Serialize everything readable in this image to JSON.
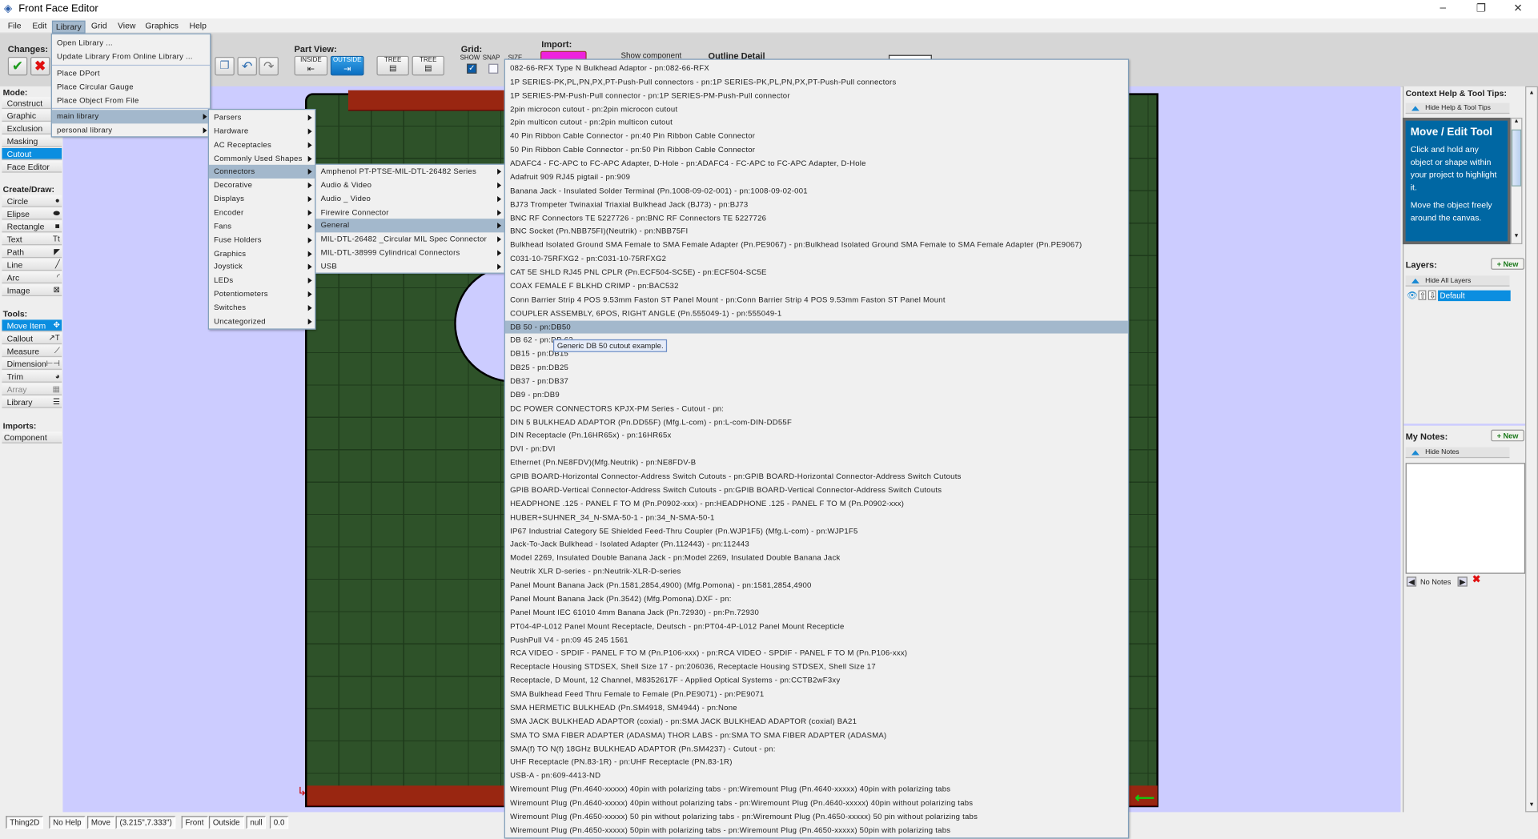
{
  "window": {
    "title": "Front Face Editor",
    "minimize": "–",
    "maximize": "❐",
    "close": "✕"
  },
  "menubar": [
    "File",
    "Edit",
    "Library",
    "Grid",
    "View",
    "Graphics",
    "Help"
  ],
  "toolbar": {
    "changes": "Changes:",
    "part_view": "Part View:",
    "inside": "INSIDE",
    "outside": "OUTSIDE",
    "tree1": "TREE",
    "tree2": "TREE",
    "grid": "Grid:",
    "show": "SHOW",
    "snap": "SNAP",
    "size": "SIZE",
    "show_checked": true,
    "snap_checked": false,
    "import": "Import:",
    "show_component": "Show component",
    "outline_detail": "Outline Detail",
    "import_color": "#ee22dd"
  },
  "left": {
    "mode_label": "Mode:",
    "modes": [
      "Construct",
      "Graphic",
      "Exclusion",
      "Masking",
      "Cutout",
      "Face Editor"
    ],
    "selected_mode": "Cutout",
    "create_label": "Create/Draw:",
    "create": [
      [
        "Circle",
        "●"
      ],
      [
        "Elipse",
        "⬬"
      ],
      [
        "Rectangle",
        "■"
      ],
      [
        "Text",
        "Tt"
      ],
      [
        "Path",
        "◤"
      ],
      [
        "Line",
        "╱"
      ],
      [
        "Arc",
        "◜"
      ],
      [
        "Image",
        "⊠"
      ]
    ],
    "tools_label": "Tools:",
    "tools": [
      [
        "Move Item",
        "✥"
      ],
      [
        "Callout",
        "↗T"
      ],
      [
        "Measure",
        "⟋"
      ],
      [
        "Dimension",
        "⊢⊣"
      ],
      [
        "Trim",
        "◕"
      ],
      [
        "Array",
        "▦"
      ],
      [
        "Library",
        "☰"
      ]
    ],
    "imports_label": "Imports:",
    "imports": [
      "Component"
    ]
  },
  "library_menu": {
    "items": [
      "Open Library ...",
      "Update Library From Online Library ...",
      "Place DPort",
      "Place Circular Gauge",
      "Place Object From File",
      "main library",
      "personal library"
    ]
  },
  "main_library": [
    "Parsers",
    "Hardware",
    "AC Receptacles",
    "Commonly Used Shapes",
    "Connectors",
    "Decorative",
    "Displays",
    "Encoder",
    "Fans",
    "Fuse Holders",
    "Graphics",
    "Joystick",
    "LEDs",
    "Potentiometers",
    "Switches",
    "Uncategorized"
  ],
  "connectors": [
    "Amphenol PT-PTSE-MIL-DTL-26482 Series",
    "Audio & Video",
    "Audio _ Video",
    "Firewire Connector",
    "General",
    "MIL-DTL-26482 _Circular MIL Spec Connector",
    "MIL-DTL-38999 Cylindrical Connectors",
    "USB"
  ],
  "general": [
    "082-66-RFX Type N Bulkhead Adaptor - pn:082-66-RFX",
    "1P SERIES-PK,PL,PN,PX,PT-Push-Pull connectors - pn:1P SERIES-PK,PL,PN,PX,PT-Push-Pull connectors",
    "1P SERIES-PM-Push-Pull connector - pn:1P SERIES-PM-Push-Pull connector",
    "2pin microcon cutout - pn:2pin microcon cutout",
    "2pin multicon cutout - pn:2pin multicon cutout",
    "40 Pin Ribbon Cable Connector - pn:40 Pin Ribbon Cable Connector",
    "50 Pin Ribbon Cable Connector - pn:50 Pin Ribbon Cable Connector",
    "ADAFC4 - FC-APC to FC-APC Adapter, D-Hole - pn:ADAFC4 - FC-APC to FC-APC Adapter, D-Hole",
    "Adafruit 909 RJ45 pigtail - pn:909",
    "Banana Jack - Insulated Solder Terminal (Pn.1008-09-02-001) - pn:1008-09-02-001",
    "BJ73 Trompeter Twinaxial Triaxial Bulkhead Jack (BJ73) - pn:BJ73",
    "BNC RF Connectors TE 5227726 - pn:BNC RF Connectors TE 5227726",
    "BNC Socket (Pn.NBB75FI)(Neutrik) - pn:NBB75FI",
    "Bulkhead Isolated Ground SMA Female to SMA Female Adapter (Pn.PE9067) - pn:Bulkhead Isolated Ground SMA Female to SMA Female Adapter (Pn.PE9067)",
    "C031-10-75RFXG2 - pn:C031-10-75RFXG2",
    "CAT 5E SHLD RJ45 PNL CPLR (Pn.ECF504-SC5E) - pn:ECF504-SC5E",
    "COAX FEMALE F BLKHD CRIMP - pn:BAC532",
    "Conn Barrier Strip 4 POS 9.53mm Faston ST Panel Mount - pn:Conn Barrier Strip 4 POS 9.53mm Faston ST Panel Mount",
    "COUPLER ASSEMBLY, 6POS, RIGHT ANGLE (Pn.555049-1) - pn:555049-1",
    "DB 50 - pn:DB50",
    "DB 62 - pn:DB 62",
    "DB15 - pn:DB15",
    "DB25 - pn:DB25",
    "DB37 - pn:DB37",
    "DB9 - pn:DB9",
    "DC POWER CONNECTORS KPJX-PM Series - Cutout - pn:",
    "DIN 5 BULKHEAD ADAPTOR (Pn.DD55F) (Mfg.L-com) - pn:L-com-DIN-DD55F",
    "DIN Receptacle (Pn.16HR65x) - pn:16HR65x",
    "DVI - pn:DVI",
    "Ethernet (Pn.NE8FDV)(Mfg.Neutrik) - pn:NE8FDV-B",
    "GPIB BOARD-Horizontal Connector-Address Switch Cutouts - pn:GPIB BOARD-Horizontal Connector-Address Switch Cutouts",
    "GPIB BOARD-Vertical Connector-Address Switch Cutouts - pn:GPIB BOARD-Vertical Connector-Address Switch Cutouts",
    "HEADPHONE .125 - PANEL F TO M (Pn.P0902-xxx) - pn:HEADPHONE .125 - PANEL F TO M (Pn.P0902-xxx)",
    "HUBER+SUHNER_34_N-SMA-50-1 - pn:34_N-SMA-50-1",
    "IP67 Industrial Category 5E Shielded Feed-Thru Coupler (Pn.WJP1F5) (Mfg.L-com) - pn:WJP1F5",
    "Jack-To-Jack Bulkhead - Isolated Adapter (Pn.112443) - pn:112443",
    "Model 2269, Insulated Double Banana Jack - pn:Model 2269, Insulated Double Banana Jack",
    "Neutrik XLR D-series - pn:Neutrik-XLR-D-series",
    "Panel Mount Banana Jack (Pn.1581,2854,4900) (Mfg.Pomona) - pn:1581,2854,4900",
    "Panel Mount Banana Jack (Pn.3542) (Mfg.Pomona).DXF - pn:",
    "Panel Mount IEC 61010 4mm Banana Jack (Pn.72930)  - pn:Pn.72930",
    "PT04-4P-L012 Panel Mount Receptacle, Deutsch - pn:PT04-4P-L012 Panel Mount Recepticle",
    "PushPull V4 - pn:09 45 245 1561",
    "RCA VIDEO - SPDIF - PANEL F TO M (Pn.P106-xxx) - pn:RCA VIDEO - SPDIF - PANEL F TO M (Pn.P106-xxx)",
    "Receptacle Housing STDSEX, Shell Size 17 - pn:206036, Receptacle Housing STDSEX, Shell Size 17",
    "Receptacle, D Mount, 12 Channel, M8352617F - Applied Optical Systems - pn:CCTB2wF3xy",
    "SMA Bulkhead Feed Thru Female to Female (Pn.PE9071) - pn:PE9071",
    "SMA HERMETIC BULKHEAD (Pn.SM4918, SM4944) - pn:None",
    "SMA JACK BULKHEAD ADAPTOR (coxial) - pn:SMA JACK BULKHEAD ADAPTOR (coxial) BA21",
    "SMA TO SMA FIBER ADAPTER (ADASMA) THOR LABS - pn:SMA TO SMA FIBER ADAPTER (ADASMA)",
    "SMA(f) TO N(f) 18GHz BULKHEAD ADAPTOR (Pn.SM4237) - Cutout - pn:",
    "UHF Receptacle (PN.83-1R) - pn:UHF Receptacle (PN.83-1R)",
    "USB-A - pn:609-4413-ND",
    "Wiremount Plug (Pn.4640-xxxxx) 40pin with polarizing tabs - pn:Wiremount Plug (Pn.4640-xxxxx) 40pin with polarizing tabs",
    "Wiremount Plug (Pn.4640-xxxxx) 40pin without polarizing tabs - pn:Wiremount Plug (Pn.4640-xxxxx) 40pin without polarizing tabs",
    "Wiremount Plug (Pn.4650-xxxxx) 50 pin without polarizing tabs - pn:Wiremount Plug (Pn.4650-xxxxx) 50 pin without polarizing tabs",
    "Wiremount Plug (Pn.4650-xxxxx) 50pin with polarizing tabs - pn:Wiremount Plug (Pn.4650-xxxxx) 50pin with polarizing tabs"
  ],
  "tooltip": "Generic DB 50 cutout example.",
  "right": {
    "help_title": "Context Help & Tool Tips:",
    "hide_help": "Hide Help & Tool Tips",
    "help_heading": "Move / Edit Tool",
    "help_p1": "Click and hold any object or shape within your project to highlight it.",
    "help_p2": "Move the object freely around the canvas.",
    "layers": "Layers:",
    "new": "+ New",
    "hide_layers": "Hide All Layers",
    "layer_name": "Default",
    "notes": "My Notes:",
    "hide_notes": "Hide Notes",
    "no_notes": "No Notes"
  },
  "status": [
    "Thing2D",
    "No Help",
    "Move",
    "(3.215\",7.333\")",
    "Front",
    "Outside",
    "null",
    "0.0"
  ]
}
